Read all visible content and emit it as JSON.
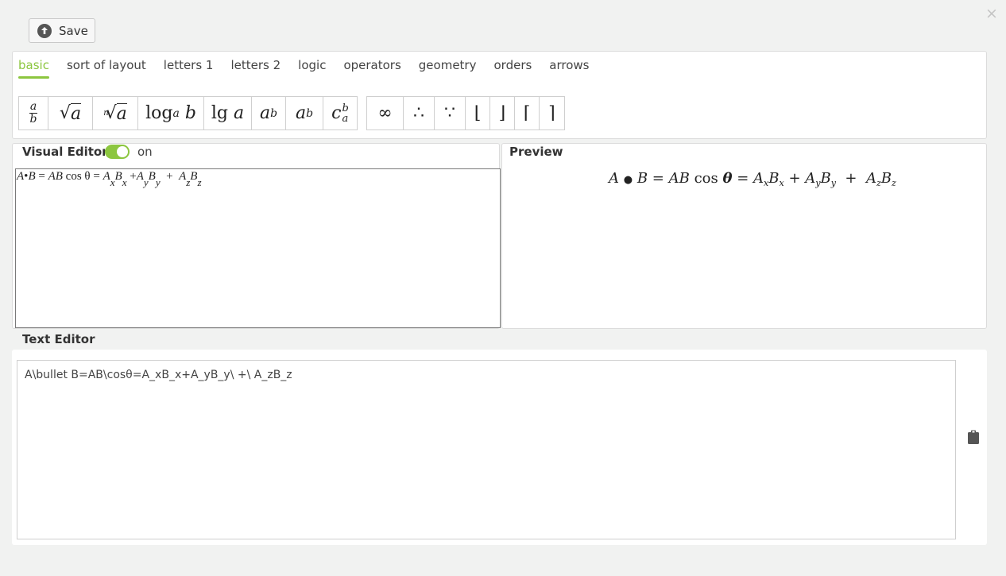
{
  "toolbar": {
    "save_label": "Save"
  },
  "tabs": [
    {
      "label": "basic",
      "active": true
    },
    {
      "label": "sort of layout"
    },
    {
      "label": "letters 1"
    },
    {
      "label": "letters 2"
    },
    {
      "label": "logic"
    },
    {
      "label": "operators"
    },
    {
      "label": "geometry"
    },
    {
      "label": "orders"
    },
    {
      "label": "arrows"
    }
  ],
  "symbols": {
    "fraction": {
      "num": "a",
      "den": "b"
    },
    "sqrt": {
      "radical": "√",
      "arg": "a"
    },
    "nthroot": {
      "index": "n",
      "radical": "√",
      "arg": "a"
    },
    "log": {
      "fn": "log",
      "base": "a",
      "arg": "b"
    },
    "lg": {
      "fn": "lg",
      "arg": "a"
    },
    "power": {
      "base": "a",
      "exp": "b"
    },
    "subscript": {
      "base": "a",
      "sub": "b"
    },
    "subsup": {
      "base": "c",
      "sup": "b",
      "sub": "a"
    },
    "infinity": "∞",
    "therefore": "∴",
    "because": "∵",
    "lfloor": "⌊",
    "rfloor": "⌋",
    "lceil": "⌈",
    "rceil": "⌉"
  },
  "visual_editor": {
    "title": "Visual Editor",
    "toggle_label": "on",
    "toggle_on": true,
    "expr": {
      "A": "A",
      "bullet": "•",
      "B": "B",
      "eq": "=",
      "AB": "AB",
      "cos": "cos",
      "theta": "θ",
      "x": "x",
      "y": "y",
      "z": "z",
      "plus": "+"
    }
  },
  "preview": {
    "title": "Preview",
    "expr": {
      "A": "A",
      "bullet": "●",
      "B": "B",
      "eq": "=",
      "AB": "AB",
      "cos": "cos",
      "theta": "θ",
      "x": "x",
      "y": "y",
      "z": "z",
      "plus": "+"
    }
  },
  "text_editor": {
    "title": "Text Editor",
    "content": "A\\bullet B=AB\\cosθ=A_xB_x+A_yB_y\\ +\\ A_zB_z"
  },
  "colors": {
    "accent": "#8cc63f"
  }
}
